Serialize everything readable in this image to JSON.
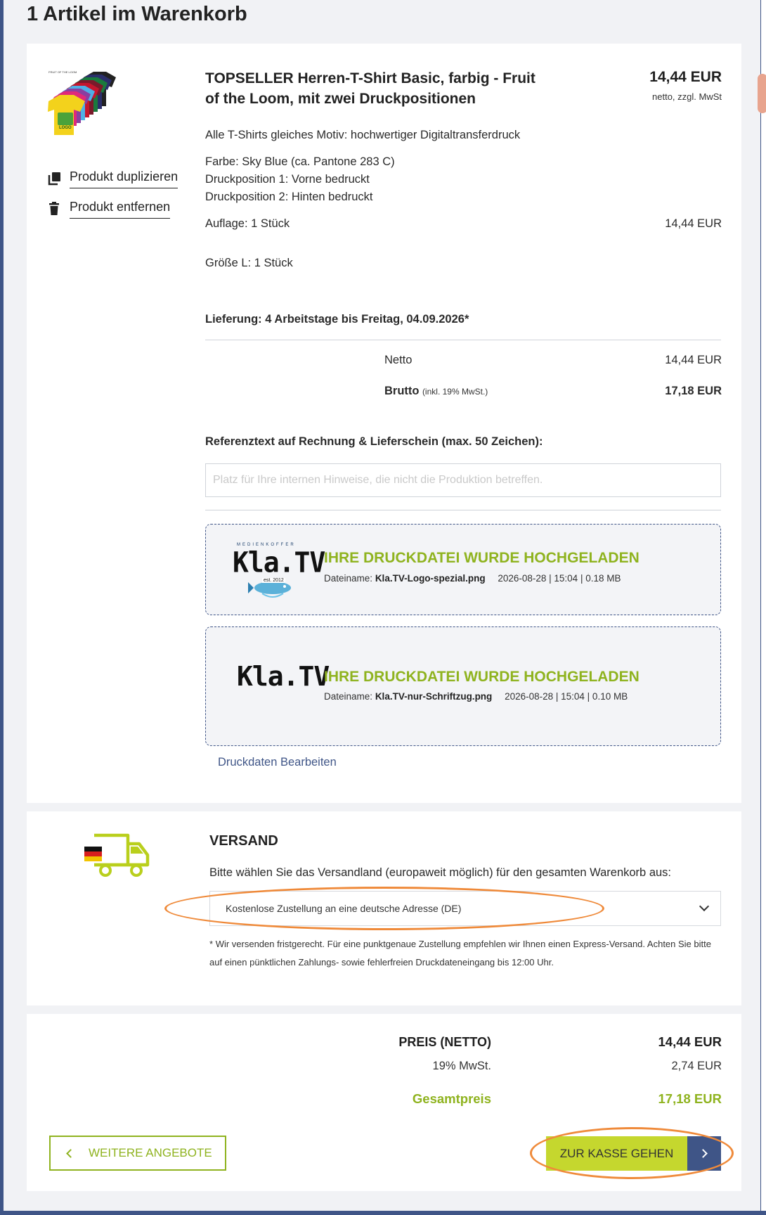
{
  "page": {
    "title": "1 Artikel im Warenkorb"
  },
  "product": {
    "thumb_brand": "FRUIT OF THE LOOM",
    "thumb_logo": "LOGO",
    "title": "TOPSELLER Herren-T-Shirt Basic, farbig - Fruit of the Loom, mit zwei Druckpositionen",
    "price": "14,44 EUR",
    "price_note": "netto, zzgl. MwSt",
    "actions": {
      "duplicate": "Produkt duplizieren",
      "remove": "Produkt entfernen"
    },
    "motif": "Alle T-Shirts gleiches Motiv: hochwertiger Digitaltransferdruck",
    "color": "Farbe: Sky Blue (ca. Pantone 283 C)",
    "print1": "Druckposition 1: Vorne bedruckt",
    "print2": "Druckposition 2: Hinten bedruckt",
    "run_label": "Auflage: 1 Stück",
    "run_price": "14,44 EUR",
    "size": "Größe L: 1 Stück",
    "delivery": "Lieferung: 4 Arbeitstage bis Freitag, 04.09.2026*",
    "netto_label": "Netto",
    "netto_value": "14,44 EUR",
    "brutto_label": "Brutto",
    "brutto_note": "(inkl. 19% MwSt.)",
    "brutto_value": "17,18 EUR",
    "ref_label": "Referenztext auf Rechnung & Lieferschein (max. 50 Zeichen):",
    "ref_placeholder": "Platz für Ihre internen Hinweise, die nicht die Produktion betreffen.",
    "ref_value": "",
    "uploads": [
      {
        "logo_text": "Kla.TV",
        "logo_top": "MEDIENKOFFER",
        "logo_badge": "est. 2012",
        "heading": "IHRE DRUCKDATEI WURDE HOCHGELADEN",
        "file_prefix": "Dateiname:",
        "file_name": "Kla.TV-Logo-spezial.png",
        "file_info": "2026-08-28 | 15:04 | 0.18 MB"
      },
      {
        "logo_text": "Kla.TV",
        "heading": "IHRE DRUCKDATEI WURDE HOCHGELADEN",
        "file_prefix": "Dateiname:",
        "file_name": "Kla.TV-nur-Schriftzug.png",
        "file_info": "2026-08-28 | 15:04 | 0.10 MB"
      }
    ],
    "edit_link": "Druckdaten Bearbeiten"
  },
  "shipping": {
    "title": "VERSAND",
    "subtitle": "Bitte wählen Sie das Versandland (europaweit möglich) für den gesamten Warenkorb aus:",
    "selected": "Kostenlose Zustellung an eine deutsche Adresse (DE)",
    "note_star": "*",
    "note": "Wir versenden fristgerecht. Für eine punktgenaue Zustellung empfehlen wir Ihnen einen Express-Versand. Achten Sie bitte auf einen pünktlichen Zahlungs- sowie fehlerfreien Druckdateneingang bis 12:00 Uhr."
  },
  "totals": {
    "net_label": "PREIS (NETTO)",
    "net_value": "14,44 EUR",
    "vat_label": "19% MwSt.",
    "vat_value": "2,74 EUR",
    "total_label": "Gesamtpreis",
    "total_value": "17,18 EUR",
    "more_button": "WEITERE ANGEBOTE",
    "checkout_button": "ZUR KASSE GEHEN"
  },
  "colors": {
    "accent_green": "#8fb31f",
    "button_green": "#c5d72e",
    "navy": "#3f5587",
    "annotation_orange": "#ef8a3a"
  }
}
